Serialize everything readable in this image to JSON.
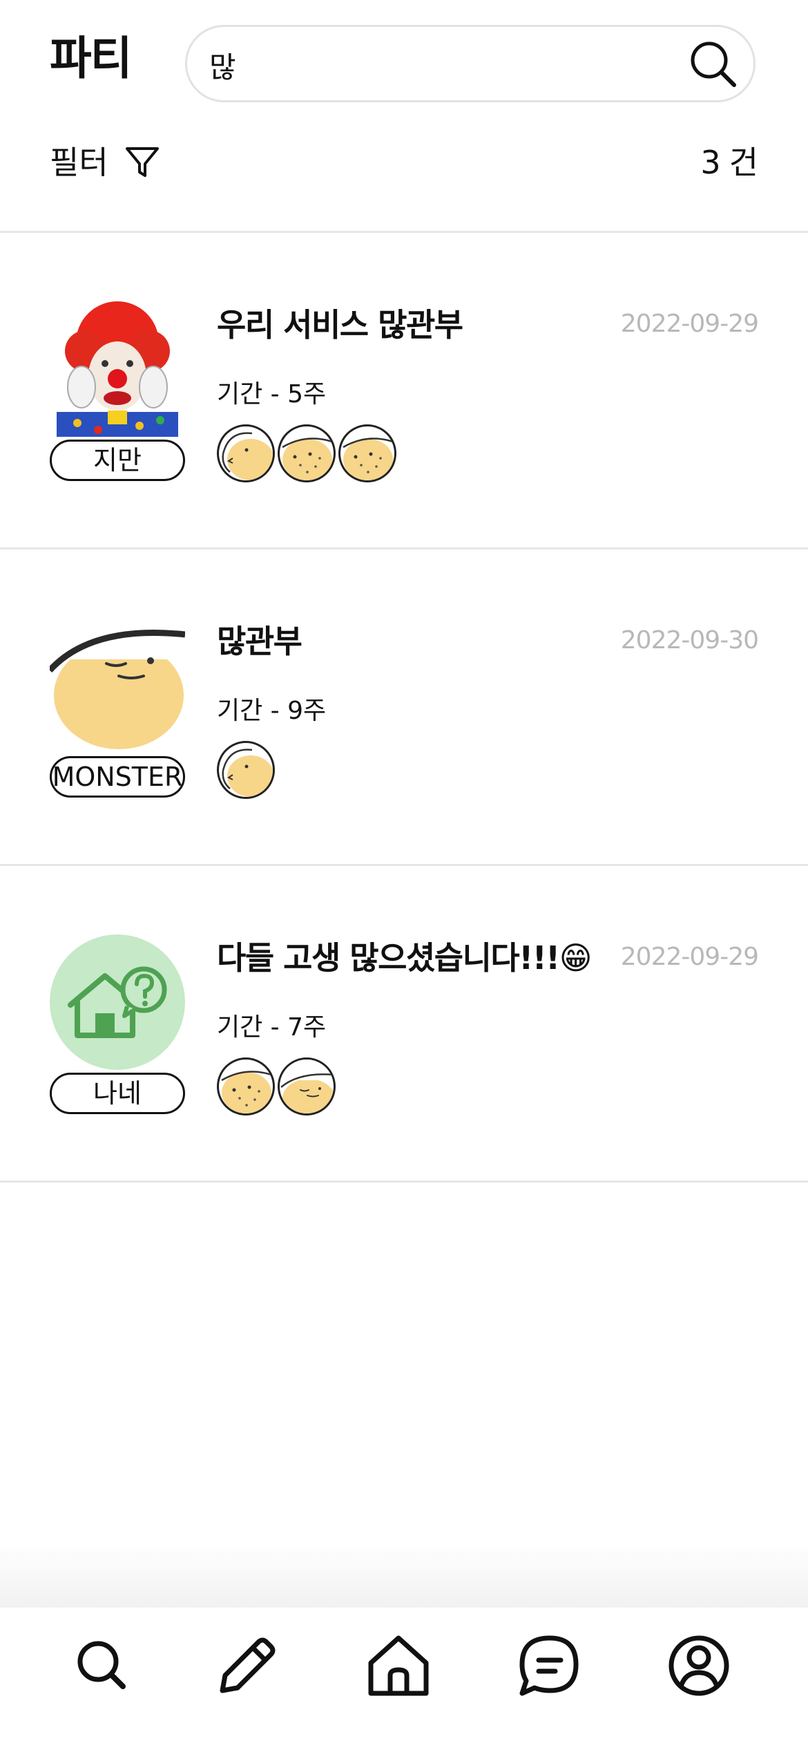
{
  "header": {
    "title": "파티",
    "search": {
      "value": "많",
      "placeholder": ""
    }
  },
  "filter": {
    "label": "필터",
    "count": "3",
    "count_unit": "건"
  },
  "parties": [
    {
      "title": "우리 서비스 많관부",
      "date": "2022-09-29",
      "period": "기간 - 5주",
      "owner": "지만",
      "thumbnail": "clown-photo",
      "members": [
        "chick-avatar",
        "potato-avatar",
        "potato-avatar"
      ]
    },
    {
      "title": "많관부",
      "date": "2022-09-30",
      "period": "기간 - 9주",
      "owner": "MONSTER",
      "thumbnail": "potato-face",
      "members": [
        "chick-avatar"
      ]
    },
    {
      "title": "다들 고생 많으셨습니다!!!😁",
      "date": "2022-09-29",
      "period": "기간 - 7주",
      "owner": "나네",
      "thumbnail": "house-question-icon",
      "members": [
        "potato-avatar",
        "potato-face-avatar"
      ]
    }
  ],
  "bottom_nav": {
    "items": [
      "search-icon",
      "pencil-icon",
      "home-icon",
      "chat-icon",
      "profile-icon"
    ]
  },
  "colors": {
    "text": "#111111",
    "date": "#b8b8b8",
    "divider": "#e6e6e6",
    "avatar_yellow": "#f7d68a",
    "house_bg": "#c6e9c7",
    "house_green": "#4ea252"
  }
}
